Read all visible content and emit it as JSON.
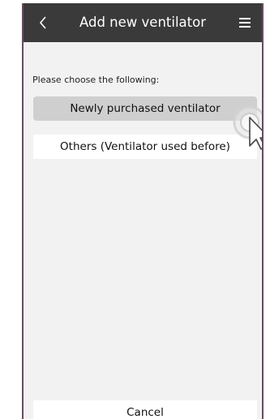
{
  "header": {
    "title": "Add new ventilator",
    "back_icon": "chevron-left-icon",
    "menu_icon": "hamburger-menu-icon"
  },
  "main": {
    "prompt": "Please choose the following:",
    "options": [
      {
        "label": "Newly purchased ventilator",
        "state": "pressed"
      },
      {
        "label": "Others (Ventilator used before)",
        "state": "default"
      }
    ],
    "cancel_label": "Cancel"
  },
  "overlay": {
    "pointer_icon": "hand-pointer-icon"
  },
  "colors": {
    "header_bg": "#3a3a3a",
    "page_bg": "#f2f2f2",
    "pressed_option_bg": "#cfcfcf",
    "frame_border": "#6b4a60"
  }
}
